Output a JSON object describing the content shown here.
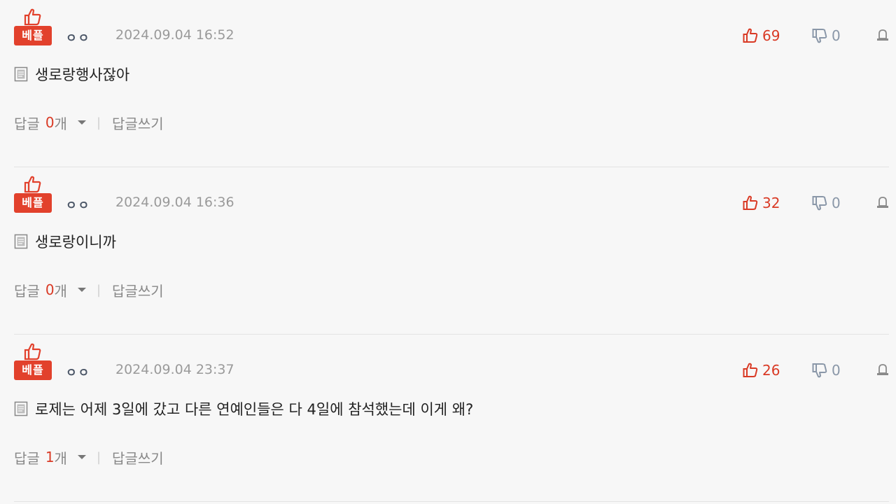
{
  "comments": [
    {
      "badge": "베플",
      "author": "ㅇㅇ",
      "date": "2024.09.04 16:52",
      "likes": "69",
      "dislikes": "0",
      "text": "생로랑행사잖아",
      "reply_label": "답글",
      "reply_count": "0",
      "reply_unit": "개",
      "write_reply": "답글쓰기"
    },
    {
      "badge": "베플",
      "author": "ㅇㅇ",
      "date": "2024.09.04 16:36",
      "likes": "32",
      "dislikes": "0",
      "text": "생로랑이니까",
      "reply_label": "답글",
      "reply_count": "0",
      "reply_unit": "개",
      "write_reply": "답글쓰기"
    },
    {
      "badge": "베플",
      "author": "ㅇㅇ",
      "date": "2024.09.04 23:37",
      "likes": "26",
      "dislikes": "0",
      "text": "로제는 어제 3일에 갔고 다른 연예인들은 다 4일에 참석했는데 이게 왜?",
      "reply_label": "답글",
      "reply_count": "1",
      "reply_unit": "개",
      "write_reply": "답글쓰기"
    }
  ],
  "colors": {
    "accent": "#e2412c",
    "muted": "#8a97a8",
    "date": "#9a9a9a"
  },
  "icons": [
    "thumbs-up-icon",
    "thumbs-down-icon",
    "report-icon",
    "document-icon",
    "caret-down-icon"
  ]
}
